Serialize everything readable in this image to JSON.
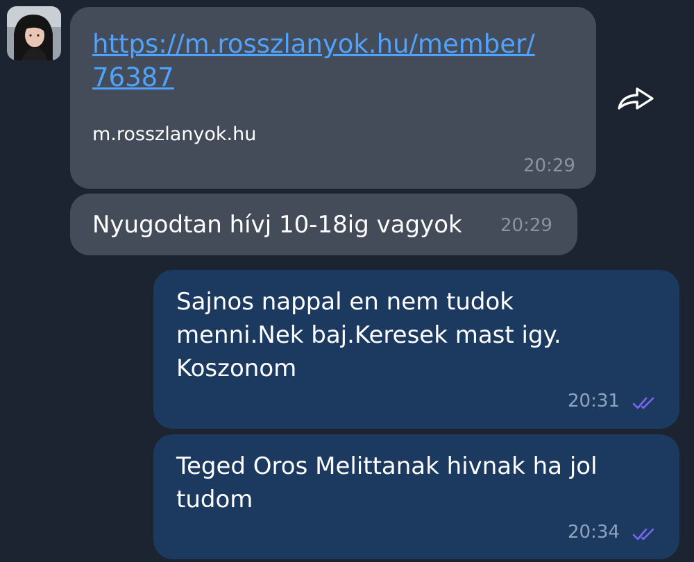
{
  "messages": [
    {
      "direction": "incoming",
      "link_url": "https://m.rosszlanyok.hu/member/76387",
      "link_domain": "m.rosszlanyok.hu",
      "time": "20:29"
    },
    {
      "direction": "incoming",
      "text": "Nyugodtan hívj 10-18ig vagyok",
      "time": "20:29"
    },
    {
      "direction": "outgoing",
      "text": "Sajnos nappal en nem tudok menni.Nek baj.Keresek mast igy. Koszonom",
      "time": "20:31",
      "status_icon": "double-check-icon"
    },
    {
      "direction": "outgoing",
      "text": "Teged Oros Melittanak hivnak ha jol tudom",
      "time": "20:34",
      "status_icon": "double-check-icon"
    }
  ],
  "icons": {
    "forward": "forward-share-icon",
    "avatar": "contact-avatar"
  },
  "colors": {
    "background": "#1b2430",
    "incoming_bubble": "#434c58",
    "outgoing_bubble": "#1c3a5f",
    "link": "#4fa3ff",
    "read_checks": "#7b68ee"
  }
}
